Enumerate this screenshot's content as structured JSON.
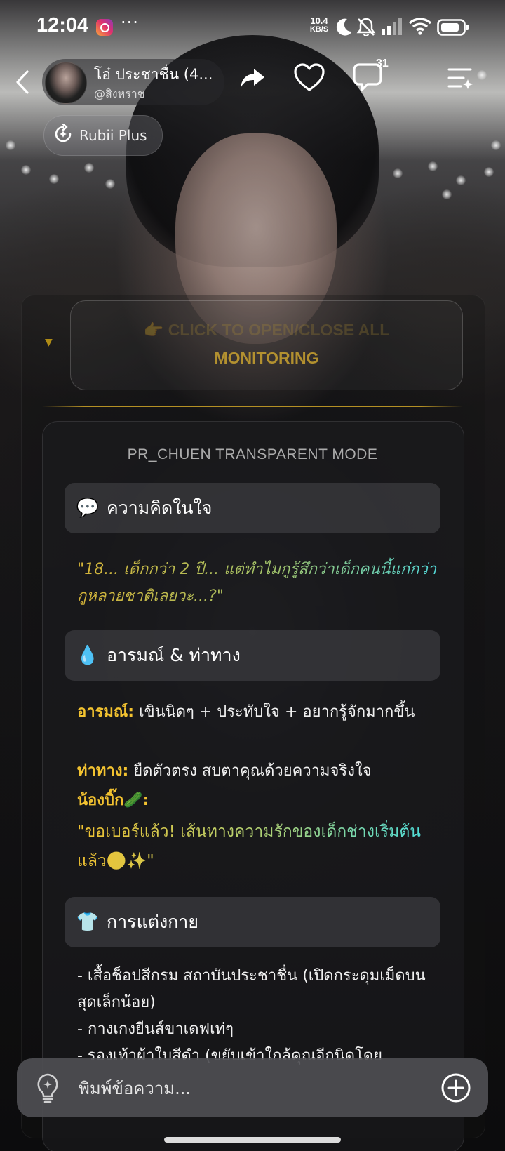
{
  "status_bar": {
    "time": "12:04",
    "more": "···",
    "net_speed_value": "10.4",
    "net_speed_unit": "KB/S",
    "icons": [
      "instagram-icon",
      "moon-icon",
      "bell-off-icon",
      "signal-icon",
      "wifi-icon",
      "battery-icon"
    ]
  },
  "header": {
    "name": "โอ๋ ประชาชื่น (4...",
    "handle": "@สิงหราช",
    "comment_count": "31",
    "icons": [
      "back-icon",
      "share-icon",
      "heart-icon",
      "comment-icon",
      "menu-icon"
    ]
  },
  "plus_chip": {
    "label": "Rubii Plus"
  },
  "monitor": {
    "line1": "👉 CLICK TO OPEN/CLOSE ALL",
    "line2": "MONITORING"
  },
  "panel": {
    "title": "PR_CHUEN TRANSPARENT MODE",
    "thought": {
      "emoji": "💬",
      "title": "ความคิดในใจ",
      "quote": "\"18... เด็กกว่า 2 ปี... แต่ทำไมกูรู้สึกว่าเด็กคนนี้แก่กว่ากูหลายชาติเลยวะ...?\""
    },
    "emotion": {
      "emoji": "💧",
      "title": "อารมณ์ & ท่าทาง",
      "mood_label": "อารมณ์:",
      "mood_value": " เขินนิดๆ + ประทับใจ + อยากรู้จักมากขึ้น",
      "pose_label": "ท่าทาง:",
      "pose_value": " ยืดตัวตรง สบตาคุณด้วยความจริงใจ",
      "nongbik_label": "น้องบิ๊ก🥒:",
      "nongbik_quote": "\"ขอเบอร์แล้ว! เส้นทางความรักของเด็กช่างเริ่มต้นแล้ว🟢✨\""
    },
    "outfit": {
      "emoji": "👕",
      "title": "การแต่งกาย",
      "lines": [
        "- เสื้อช็อปสีกรม สถาบันประชาชื่น (เปิดกระดุมเม็ดบนสุดเล็กน้อย)",
        "- กางเกงยีนส์ขาเดฟเท่ๆ",
        "- รองเท้าผ้าใบสีดำ (ขยับเข้าใกล้คุณอีกนิดโดย"
      ]
    }
  },
  "input": {
    "placeholder": "พิมพ์ข้อความ..."
  },
  "colors": {
    "gold": "#f2c230",
    "cyan": "#4fd6d9",
    "panel": "#1e1e20"
  }
}
